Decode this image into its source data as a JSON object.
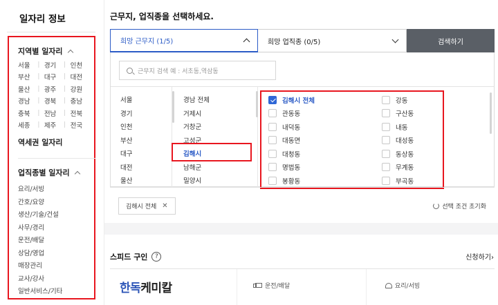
{
  "sidebar": {
    "title": "일자리 정보",
    "region_header": "지역별 일자리",
    "regions": [
      [
        "서울",
        "경기",
        "인천"
      ],
      [
        "부산",
        "대구",
        "대전"
      ],
      [
        "울산",
        "광주",
        "강원"
      ],
      [
        "경남",
        "경북",
        "충남"
      ],
      [
        "충북",
        "전남",
        "전북"
      ],
      [
        "세종",
        "제주",
        "전국"
      ]
    ],
    "station_header": "역세권 일자리",
    "job_header": "업직종별 일자리",
    "jobs": [
      "요리/서빙",
      "간호/요양",
      "생산/기술/건설",
      "사무/경리",
      "운전/배달",
      "상담/영업",
      "매장관리",
      "교사/강사",
      "일반서비스/기타"
    ]
  },
  "main": {
    "title": "근무지, 업직종을 선택하세요.",
    "tab_location": "희망 근무지 (1/5)",
    "tab_job": "희망 업직종 (0/5)",
    "search_button": "검색하기",
    "search_placeholder": "근무지 검색 예 : 서초동,역삼동",
    "provinces": [
      "서울",
      "경기",
      "인천",
      "부산",
      "대구",
      "대전",
      "울산"
    ],
    "cities": [
      "경남 전체",
      "거제시",
      "거창군",
      "고성군",
      "김해시",
      "남해군",
      "밀양시"
    ],
    "selected_city": "김해시",
    "dongs": [
      {
        "name": "김해시 전체",
        "checked": true
      },
      {
        "name": "강동",
        "checked": false
      },
      {
        "name": "관동동",
        "checked": false
      },
      {
        "name": "구산동",
        "checked": false
      },
      {
        "name": "내덕동",
        "checked": false
      },
      {
        "name": "내동",
        "checked": false
      },
      {
        "name": "대동면",
        "checked": false
      },
      {
        "name": "대성동",
        "checked": false
      },
      {
        "name": "대청동",
        "checked": false
      },
      {
        "name": "동상동",
        "checked": false
      },
      {
        "name": "명법동",
        "checked": false
      },
      {
        "name": "무계동",
        "checked": false
      },
      {
        "name": "봉황동",
        "checked": false
      },
      {
        "name": "부곡동",
        "checked": false
      }
    ],
    "selected_chip": "김해시 전체",
    "chip_close": "✕",
    "reset_label": "선택 조건 초기화"
  },
  "speed": {
    "title": "스피드 구인",
    "help": "?",
    "apply_link": "신청하기",
    "apply_arrow": "›",
    "logo_part1": "한독",
    "logo_part2": "케미칼",
    "category1": "운전/배달",
    "category2": "요리/서빙"
  },
  "colors": {
    "accent_blue": "#2a5ac6",
    "highlight_red": "#e8151e",
    "search_button_bg": "#5a5f66"
  }
}
